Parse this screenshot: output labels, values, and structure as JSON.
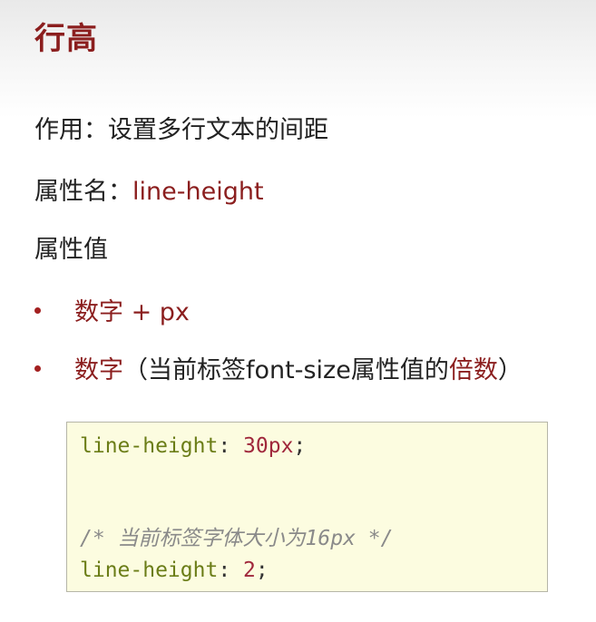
{
  "title": "行高",
  "purpose": {
    "label": "作用：",
    "text": "设置多行文本的间距"
  },
  "property_name": {
    "label": "属性名：",
    "value": "line-height"
  },
  "property_value": {
    "label": "属性值"
  },
  "bullets": [
    {
      "highlight": "数字",
      "rest": " + px"
    },
    {
      "highlight": "数字",
      "open": "（当前标签font-size属性值的",
      "highlight2": "倍数",
      "close": "）"
    }
  ],
  "code": {
    "line1_prop": "line-height",
    "line1_colon": ": ",
    "line1_value": "30px",
    "line1_semi": ";",
    "comment": "/* 当前标签字体大小为16px */",
    "line3_prop": "line-height",
    "line3_colon": ": ",
    "line3_value": "2",
    "line3_semi": ";"
  },
  "colors": {
    "accent_red": "#8b1e1e",
    "code_background": "#fcfce0",
    "code_keyword": "#6b7d17",
    "code_number": "#a0283c",
    "code_comment": "#8a8a8a"
  }
}
